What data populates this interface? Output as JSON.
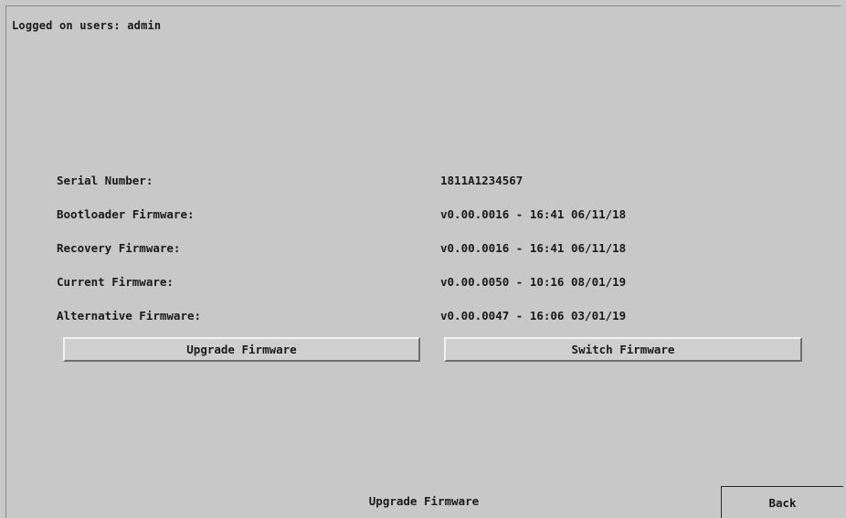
{
  "header": {
    "logged_on_users": "Logged on users: admin"
  },
  "firmware_info": [
    {
      "label": "Serial Number:",
      "value": "1811A1234567"
    },
    {
      "label": "Bootloader Firmware:",
      "value": "v0.00.0016 - 16:41 06/11/18"
    },
    {
      "label": "Recovery Firmware:",
      "value": "v0.00.0016 - 16:41 06/11/18"
    },
    {
      "label": "Current Firmware:",
      "value": "v0.00.0050 - 10:16 08/01/19"
    },
    {
      "label": "Alternative Firmware:",
      "value": "v0.00.0047 - 16:06 03/01/19"
    }
  ],
  "actions": {
    "upgrade_label": "Upgrade Firmware",
    "switch_label": "Switch Firmware"
  },
  "footer": {
    "title": "Upgrade Firmware",
    "back_label": "Back"
  }
}
